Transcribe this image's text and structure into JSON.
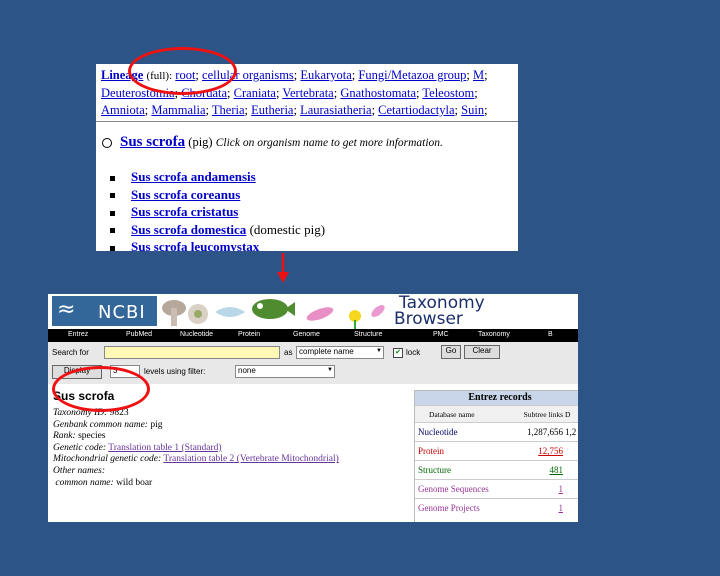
{
  "lineage": {
    "label": "Lineage",
    "full_note": "(full):",
    "line1": [
      "root",
      "cellular organisms",
      "Eukaryota",
      "Fungi/Metazoa group",
      "M"
    ],
    "line2": [
      "Deuterostomia",
      "Chordata",
      "Craniata",
      "Vertebrata",
      "Gnathostomata",
      "Teleostom"
    ],
    "line3": [
      "Amniota",
      "Mammalia",
      "Theria",
      "Eutheria",
      "Laurasiatheria",
      "Cetartiodactyla",
      "Suin"
    ],
    "organism": "Sus scrofa",
    "organism_common": "(pig)",
    "organism_note": "Click on organism name to get more information.",
    "subspecies": [
      {
        "name": "Sus scrofa andamensis",
        "note": ""
      },
      {
        "name": "Sus scrofa coreanus",
        "note": ""
      },
      {
        "name": "Sus scrofa cristatus",
        "note": ""
      },
      {
        "name": "Sus scrofa domestica",
        "note": "(domestic pig)"
      },
      {
        "name": "Sus scrofa leucomystax",
        "note": ""
      }
    ]
  },
  "ncbi": {
    "logo": "NCBI",
    "title_line1": "Taxonomy",
    "title_line2": "Browser",
    "nav": [
      "Entrez",
      "PubMed",
      "Nucleotide",
      "Protein",
      "Genome",
      "Structure",
      "PMC",
      "Taxonomy",
      "B"
    ],
    "search_label": "Search for",
    "as_label": "as",
    "as_value": "complete name",
    "lock_label": "lock",
    "go_label": "Go",
    "clear_label": "Clear",
    "display_label": "Display",
    "display_value": "3",
    "levels_label": "levels using filter:",
    "filter_value": "none",
    "species_title": "Sus scrofa",
    "info": {
      "taxonomy_id_label": "Taxonomy ID:",
      "taxonomy_id": "9823",
      "genbank_label": "Genbank common name:",
      "genbank": "pig",
      "rank_label": "Rank:",
      "rank": "species",
      "genetic_code_label": "Genetic code:",
      "genetic_code": "Translation table 1 (Standard)",
      "mito_label": "Mitochondrial genetic code:",
      "mito": "Translation table 2 (Vertebrate Mitochondrial)",
      "other_names_label": "Other names:",
      "common_name_label": "common name:",
      "common_name": "wild boar"
    },
    "entrez": {
      "title": "Entrez records",
      "col1": "Database name",
      "col2": "Subtree links",
      "col3": "D",
      "rows": [
        {
          "db": "Nucleotide",
          "count": "1,287,656",
          "extra": "1,2",
          "color": "#000066"
        },
        {
          "db": "Protein",
          "count": "12,756",
          "extra": "",
          "color": "#cc0000"
        },
        {
          "db": "Structure",
          "count": "481",
          "extra": "",
          "color": "#006600"
        },
        {
          "db": "Genome Sequences",
          "count": "1",
          "extra": "",
          "color": "#993399"
        },
        {
          "db": "Genome Projects",
          "count": "1",
          "extra": "",
          "color": "#993399"
        }
      ]
    }
  },
  "colors": {
    "background": "#2c5487",
    "annotation": "#e11111",
    "link": "#0000cc"
  }
}
